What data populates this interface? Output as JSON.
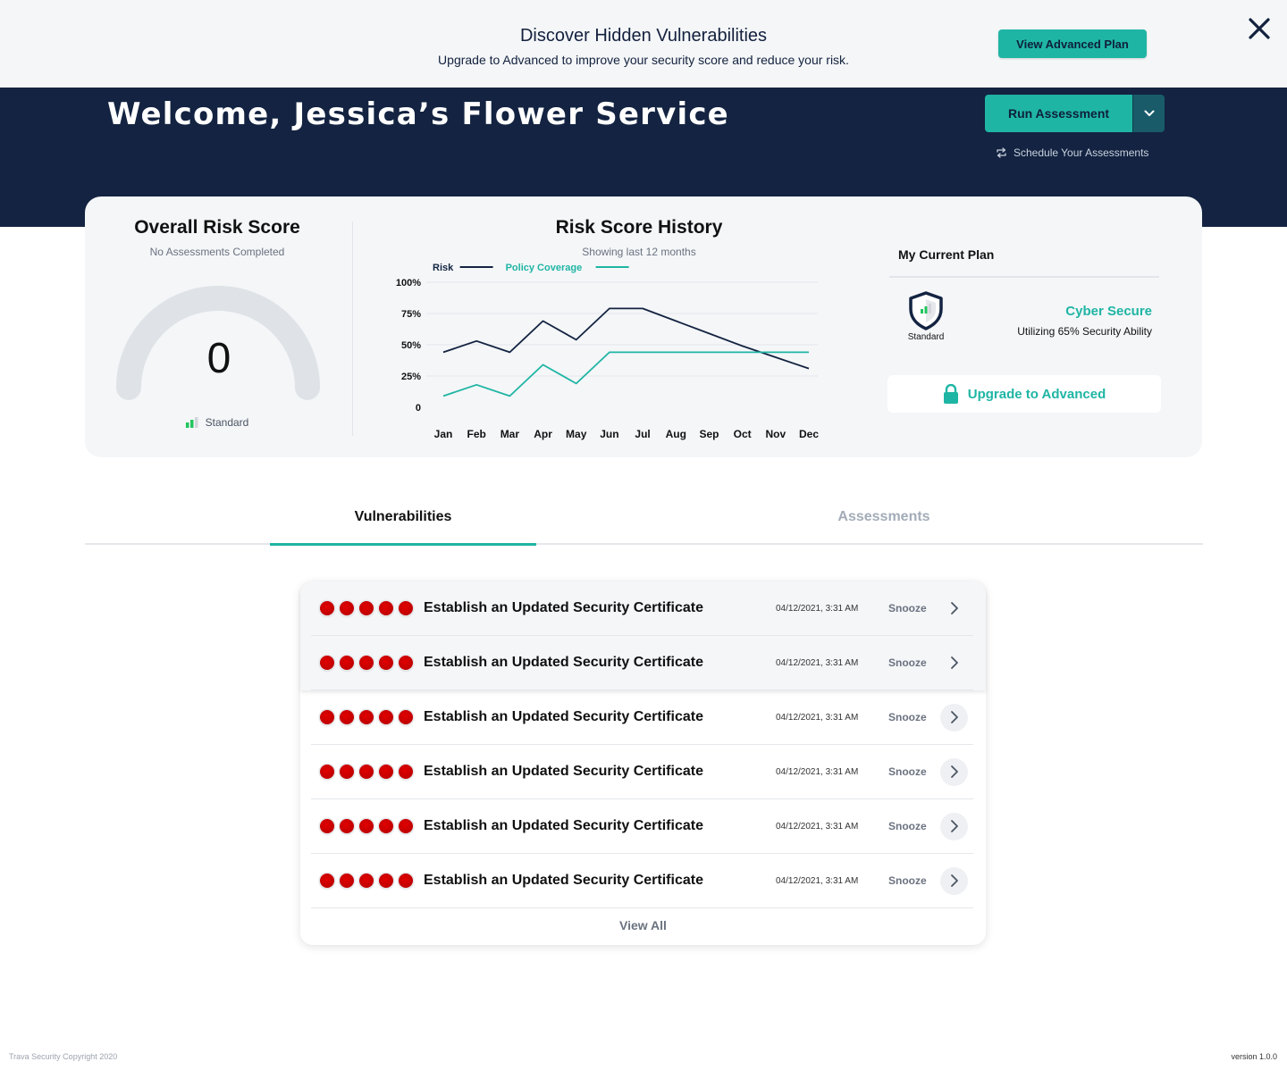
{
  "banner": {
    "title": "Discover Hidden Vulnerabilities",
    "subtitle": "Upgrade to Advanced to improve your security score and reduce your risk.",
    "button_label": "View Advanced Plan",
    "close_icon": "close-icon"
  },
  "header": {
    "welcome": "Welcome, Jessica’s Flower Service",
    "run_button_label": "Run Assessment",
    "run_dropdown_icon": "chevron-down-icon",
    "schedule_label": "Schedule Your Assessments",
    "schedule_icon": "repeat-icon"
  },
  "risk_score": {
    "title": "Overall Risk Score",
    "subtitle": "No Assessments Completed",
    "value": "0",
    "legend_label": "Standard"
  },
  "history": {
    "title": "Risk Score History",
    "subtitle": "Showing last 12 months"
  },
  "chart_data": {
    "type": "line",
    "title": "Risk Score History",
    "x": [
      "Jan",
      "Feb",
      "Mar",
      "Apr",
      "May",
      "Jun",
      "Jul",
      "Aug",
      "Sep",
      "Oct",
      "Nov",
      "Dec"
    ],
    "y_ticks": [
      "100%",
      "75%",
      "50%",
      "25%",
      "0"
    ],
    "ylim": [
      0,
      100
    ],
    "grid": true,
    "legend": "top-left",
    "series": [
      {
        "name": "Risk",
        "color": "#132341",
        "values": [
          44,
          53,
          44,
          69,
          54,
          79,
          79,
          69,
          59,
          49,
          40,
          31
        ]
      },
      {
        "name": "Policy Coverage",
        "color": "#1fb5a4",
        "values": [
          9,
          18,
          9,
          34,
          19,
          44,
          44,
          44,
          44,
          44,
          44,
          44
        ]
      }
    ]
  },
  "plan": {
    "title": "My Current Plan",
    "tier_label": "Standard",
    "name": "Cyber Secure",
    "utilization": "Utilizing 65% Security Ability",
    "upgrade_label": "Upgrade to Advanced",
    "upgrade_icon": "lock-icon"
  },
  "tabs": [
    {
      "label": "Vulnerabilities",
      "active": true
    },
    {
      "label": "Assessments",
      "active": false
    }
  ],
  "vulnerabilities": {
    "rows": [
      {
        "severity": 5,
        "title": "Establish an Updated Security Certificate",
        "date": "04/12/2021, 3:31 AM",
        "action": "Snooze"
      },
      {
        "severity": 5,
        "title": "Establish an Updated Security Certificate",
        "date": "04/12/2021, 3:31 AM",
        "action": "Snooze"
      },
      {
        "severity": 5,
        "title": "Establish an Updated Security Certificate",
        "date": "04/12/2021, 3:31 AM",
        "action": "Snooze"
      },
      {
        "severity": 5,
        "title": "Establish an Updated Security Certificate",
        "date": "04/12/2021, 3:31 AM",
        "action": "Snooze"
      },
      {
        "severity": 5,
        "title": "Establish an Updated Security Certificate",
        "date": "04/12/2021, 3:31 AM",
        "action": "Snooze"
      },
      {
        "severity": 5,
        "title": "Establish an Updated Security Certificate",
        "date": "04/12/2021, 3:31 AM",
        "action": "Snooze"
      }
    ],
    "view_all_label": "View All"
  },
  "footer": {
    "copyright": "Trava Security Copyright 2020",
    "version": "version 1.0.0"
  },
  "colors": {
    "navy": "#132341",
    "teal": "#1fb5a4",
    "severity_red": "#d00000"
  }
}
